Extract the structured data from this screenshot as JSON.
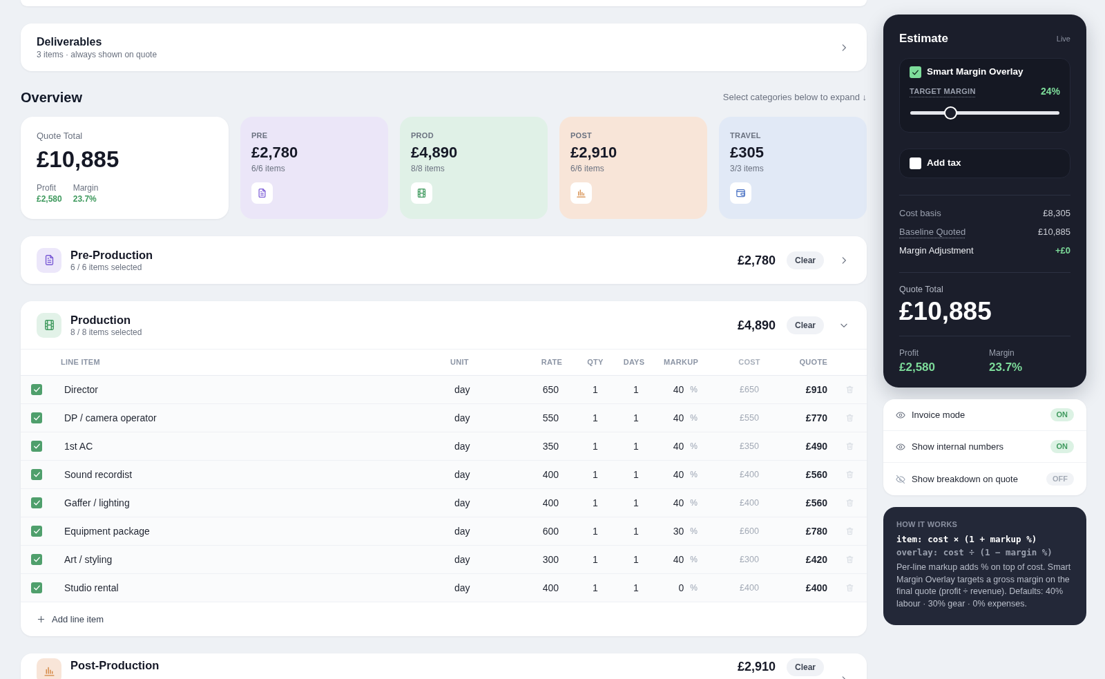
{
  "deliverables": {
    "title": "Deliverables",
    "subtitle": "3 items · always shown on quote",
    "expanded": false
  },
  "overview": {
    "title": "Overview",
    "hint": "Select categories below to expand ↓",
    "total": {
      "label": "Quote Total",
      "value": "£10,885",
      "stats": [
        {
          "label": "Profit",
          "value": "£2,580"
        },
        {
          "label": "Margin",
          "value": "23.7%"
        }
      ]
    },
    "categories": [
      {
        "kind": "pre",
        "label": "PRE",
        "value": "£2,780",
        "count": "6/6 items",
        "color": "#ebe6f8"
      },
      {
        "kind": "prod",
        "label": "PROD",
        "value": "£4,890",
        "count": "8/8 items",
        "color": "#e0f1e7"
      },
      {
        "kind": "post",
        "label": "POST",
        "value": "£2,910",
        "count": "6/6 items",
        "color": "#f8e5d8"
      },
      {
        "kind": "travel",
        "label": "TRAVEL",
        "value": "£305",
        "count": "3/3 items",
        "color": "#e1e9f6"
      }
    ]
  },
  "sections": [
    {
      "kind": "pre",
      "title": "Pre-Production",
      "subtitle": "6 / 6 items selected",
      "amount": "£2,780",
      "clear": "Clear",
      "expanded": false,
      "color": "#ece7fa"
    },
    {
      "kind": "prod",
      "title": "Production",
      "subtitle": "8 / 8 items selected",
      "amount": "£4,890",
      "clear": "Clear",
      "expanded": true,
      "color": "#e2f2e8",
      "table": {
        "columns": [
          {
            "label": "LINE ITEM",
            "dimmed": false
          },
          {
            "label": "UNIT",
            "dimmed": false
          },
          {
            "label": "RATE",
            "dimmed": false
          },
          {
            "label": "QTY",
            "dimmed": false
          },
          {
            "label": "DAYS",
            "dimmed": false
          },
          {
            "label": "MARKUP",
            "dimmed": false
          },
          {
            "label": "COST",
            "dimmed": true
          },
          {
            "label": "QUOTE",
            "dimmed": false
          }
        ],
        "rows": [
          {
            "checked": true,
            "name": "Director",
            "unit": "day",
            "rate": "650",
            "qty": "1",
            "days": "1",
            "markup": "40",
            "markup_unit": "%",
            "cost": "£650",
            "quote": "£910"
          },
          {
            "checked": true,
            "name": "DP / camera operator",
            "unit": "day",
            "rate": "550",
            "qty": "1",
            "days": "1",
            "markup": "40",
            "markup_unit": "%",
            "cost": "£550",
            "quote": "£770"
          },
          {
            "checked": true,
            "name": "1st AC",
            "unit": "day",
            "rate": "350",
            "qty": "1",
            "days": "1",
            "markup": "40",
            "markup_unit": "%",
            "cost": "£350",
            "quote": "£490"
          },
          {
            "checked": true,
            "name": "Sound recordist",
            "unit": "day",
            "rate": "400",
            "qty": "1",
            "days": "1",
            "markup": "40",
            "markup_unit": "%",
            "cost": "£400",
            "quote": "£560"
          },
          {
            "checked": true,
            "name": "Gaffer / lighting",
            "unit": "day",
            "rate": "400",
            "qty": "1",
            "days": "1",
            "markup": "40",
            "markup_unit": "%",
            "cost": "£400",
            "quote": "£560"
          },
          {
            "checked": true,
            "name": "Equipment package",
            "unit": "day",
            "rate": "600",
            "qty": "1",
            "days": "1",
            "markup": "30",
            "markup_unit": "%",
            "cost": "£600",
            "quote": "£780"
          },
          {
            "checked": true,
            "name": "Art / styling",
            "unit": "day",
            "rate": "300",
            "qty": "1",
            "days": "1",
            "markup": "40",
            "markup_unit": "%",
            "cost": "£300",
            "quote": "£420"
          },
          {
            "checked": true,
            "name": "Studio rental",
            "unit": "day",
            "rate": "400",
            "qty": "1",
            "days": "1",
            "markup": "0",
            "markup_unit": "%",
            "cost": "£400",
            "quote": "£400"
          }
        ],
        "add_item": "Add line item"
      }
    },
    {
      "kind": "post",
      "title": "Post-Production",
      "amount": "£2,910",
      "clear": "Clear",
      "expanded": false,
      "color": "#f8e5d8"
    }
  ],
  "estimate": {
    "title": "Estimate",
    "badge": "Live",
    "overlay": {
      "label": "Smart Margin Overlay",
      "checked": true,
      "slider_label": "TARGET MARGIN",
      "reading": "24%",
      "level": 0.27
    },
    "tax": {
      "label": "Add tax",
      "checked": false
    },
    "lines": [
      {
        "kind": "plain",
        "label": "Cost basis",
        "value": "£8,305"
      },
      {
        "kind": "hint",
        "label": "Baseline Quoted",
        "value": "£10,885"
      },
      {
        "kind": "adjustment",
        "label": "Margin Adjustment",
        "value": "+£0"
      }
    ],
    "total": {
      "label": "Quote Total",
      "value": "£10,885"
    },
    "stats": [
      {
        "label": "Profit",
        "value": "£2,580"
      },
      {
        "label": "Margin",
        "value": "23.7%"
      }
    ]
  },
  "toggles": [
    {
      "label": "Invoice mode",
      "badge": "ON",
      "on": true
    },
    {
      "label": "Show internal numbers",
      "badge": "ON",
      "on": true
    },
    {
      "label": "Show breakdown on quote",
      "badge": "OFF",
      "on": false
    }
  ],
  "how_it_works": {
    "title": "HOW IT WORKS",
    "formulas": [
      {
        "kind": "primary",
        "text": "item: cost × (1 + markup %)"
      },
      {
        "kind": "secondary",
        "text": "overlay: cost ÷ (1 − margin %)"
      }
    ],
    "body": "Per-line markup adds % on top of cost. Smart Margin Overlay targets a gross margin on the final quote (profit ÷ revenue). Defaults: 40% labour · 30% gear · 0% expenses."
  }
}
